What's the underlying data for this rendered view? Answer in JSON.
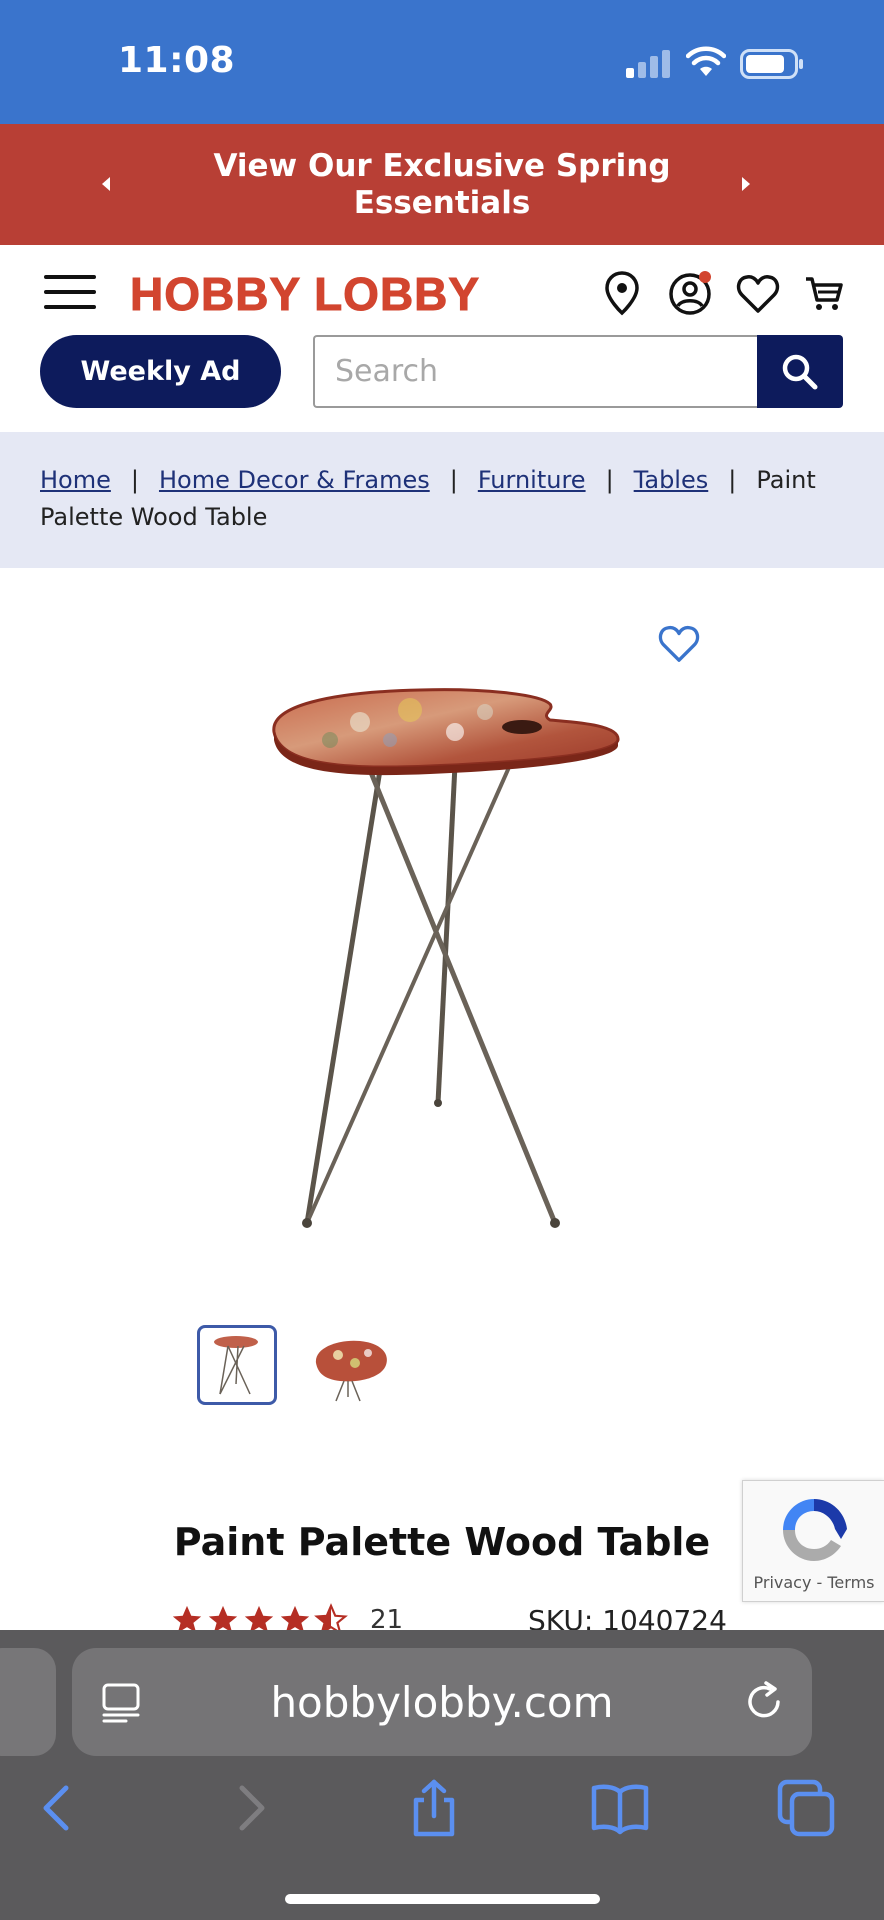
{
  "status_bar": {
    "time": "11:08"
  },
  "promo": {
    "text": "View Our Exclusive Spring Essentials"
  },
  "header": {
    "logo": "HOBBY LOBBY",
    "weekly_ad": "Weekly Ad",
    "search_placeholder": "Search"
  },
  "breadcrumb": {
    "items": [
      "Home",
      "Home Decor & Frames",
      "Furniture",
      "Tables"
    ],
    "separator": "|",
    "current": "Paint Palette Wood Table"
  },
  "product": {
    "title": "Paint Palette Wood Table",
    "rating": 4.5,
    "review_count": "21",
    "sku": "SKU: 1040724",
    "thumbnail_count": 2,
    "selected_thumbnail": 1
  },
  "recaptcha": {
    "links": "Privacy - Terms"
  },
  "browser": {
    "url": "hobbylobby.com"
  },
  "colors": {
    "status_bar": "#3a74cc",
    "promo": "#b83f35",
    "brand_red": "#d2452f",
    "navy": "#0d1b5c",
    "breadcrumb_bg": "#e5e8f4",
    "star": "#b52e24",
    "safari_link": "#5b8ff0"
  },
  "icons": [
    "hamburger-icon",
    "location-pin-icon",
    "account-icon",
    "heart-icon",
    "cart-icon",
    "search-icon",
    "reload-icon",
    "back-icon",
    "forward-icon",
    "share-icon",
    "bookmarks-icon",
    "tabs-icon"
  ]
}
